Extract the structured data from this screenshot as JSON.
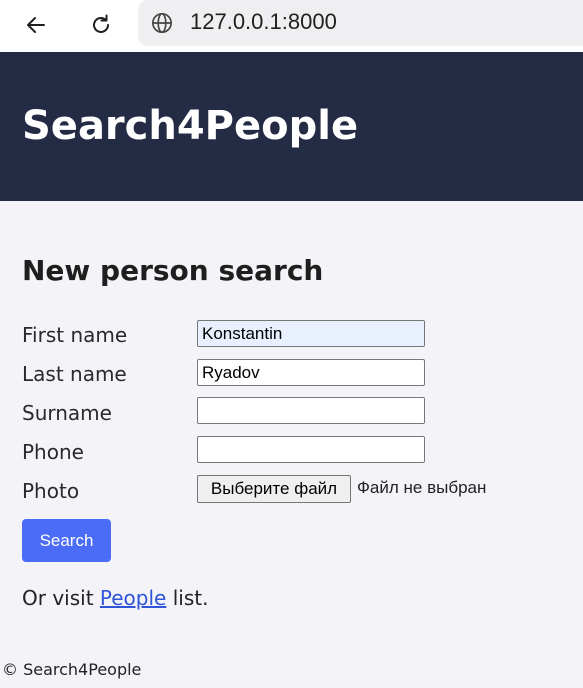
{
  "browser": {
    "url": "127.0.0.1:8000",
    "back_icon": "arrow-left-icon",
    "reload_icon": "reload-icon",
    "site_info_icon": "globe-icon"
  },
  "header": {
    "title": "Search4People",
    "background_color": "#232b45"
  },
  "form": {
    "heading": "New person search",
    "fields": [
      {
        "label": "First name",
        "value": "Konstantin"
      },
      {
        "label": "Last name",
        "value": "Ryadov"
      },
      {
        "label": "Surname",
        "value": ""
      },
      {
        "label": "Phone",
        "value": ""
      }
    ],
    "photo": {
      "label": "Photo",
      "button_label": "Выберите файл",
      "status": "Файл не выбран"
    },
    "submit_label": "Search",
    "accent_color": "#4a6cf7"
  },
  "visit": {
    "prefix": "Or visit ",
    "link_text": "People",
    "suffix": " list."
  },
  "footer": {
    "text": "© Search4People"
  }
}
